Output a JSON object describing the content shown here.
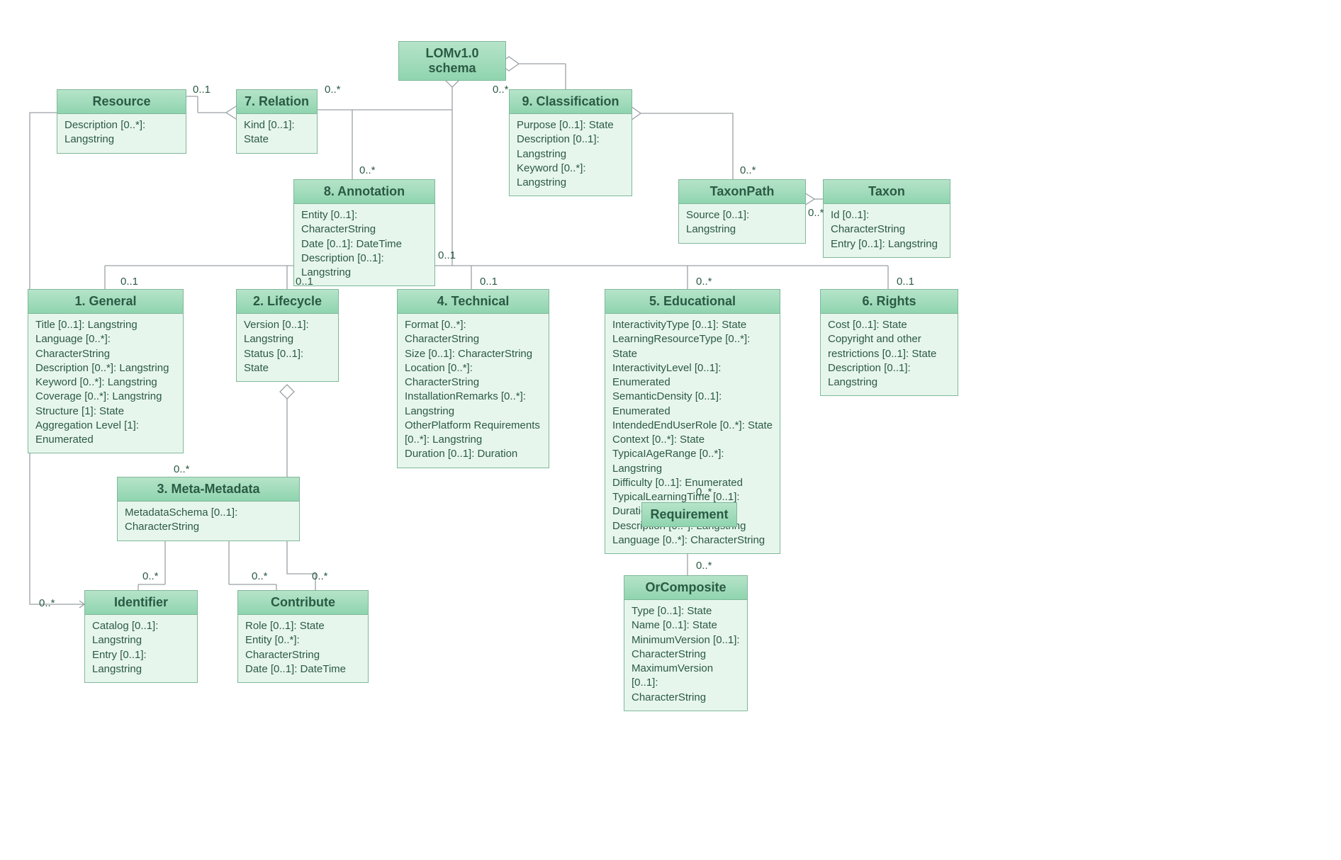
{
  "root": {
    "title": "LOMv1.0 schema"
  },
  "resource": {
    "title": "Resource",
    "attrs": [
      "Description [0..*]: Langstring"
    ]
  },
  "relation": {
    "title": "7. Relation",
    "attrs": [
      "Kind [0..1]: State"
    ]
  },
  "classification": {
    "title": "9. Classification",
    "attrs": [
      "Purpose [0..1]: State",
      "Description [0..1]: Langstring",
      "Keyword [0..*]: Langstring"
    ]
  },
  "annotation": {
    "title": "8. Annotation",
    "attrs": [
      "Entity [0..1]: CharacterString",
      "Date [0..1]: DateTime",
      "Description [0..1]: Langstring"
    ]
  },
  "taxonpath": {
    "title": "TaxonPath",
    "attrs": [
      "Source [0..1]: Langstring"
    ]
  },
  "taxon": {
    "title": "Taxon",
    "attrs": [
      "Id [0..1]: CharacterString",
      "Entry [0..1]: Langstring"
    ]
  },
  "general": {
    "title": "1. General",
    "attrs": [
      "Title [0..1]: Langstring",
      "Language [0..*]: CharacterString",
      "Description [0..*]: Langstring",
      "Keyword [0..*]: Langstring",
      "Coverage [0..*]: Langstring",
      "Structure [1]: State",
      "Aggregation Level [1]: Enumerated"
    ]
  },
  "lifecycle": {
    "title": "2. Lifecycle",
    "attrs": [
      "Version [0..1]:",
      "Langstring",
      "Status [0..1]: State"
    ]
  },
  "technical": {
    "title": "4. Technical",
    "attrs": [
      "Format [0..*]: CharacterString",
      "Size [0..1]: CharacterString",
      "Location [0..*]: CharacterString",
      "InstallationRemarks [0..*]:",
      "Langstring",
      "OtherPlatform Requirements",
      "[0..*]: Langstring",
      "Duration [0..1]: Duration"
    ]
  },
  "educational": {
    "title": "5. Educational",
    "attrs": [
      "InteractivityType [0..1]: State",
      "LearningResourceType [0..*]: State",
      "InteractivityLevel [0..1]: Enumerated",
      "SemanticDensity [0..1]: Enumerated",
      "IntendedEndUserRole [0..*]: State",
      "Context [0..*]: State",
      "TypicaIAgeRange [0..*]: Langstring",
      "Difficulty [0..1]: Enumerated",
      "TypicalLearningTime [0..1]: Duration",
      "Description [0..*]: Langstring",
      "Language [0..*]: CharacterString"
    ]
  },
  "rights": {
    "title": "6. Rights",
    "attrs": [
      "Cost [0..1]: State",
      "Copyright and other",
      "restrictions [0..1]: State",
      "Description [0..1]: Langstring"
    ]
  },
  "metametadata": {
    "title": "3. Meta-Metadata",
    "attrs": [
      "MetadataSchema [0..1]: CharacterString"
    ]
  },
  "identifier": {
    "title": "Identifier",
    "attrs": [
      "Catalog [0..1]: Langstring",
      "Entry [0..1]: Langstring"
    ]
  },
  "contribute": {
    "title": "Contribute",
    "attrs": [
      "Role [0..1]: State",
      "Entity [0..*]: CharacterString",
      "Date [0..1]: DateTime"
    ]
  },
  "requirement": {
    "title": "Requirement"
  },
  "orcomposite": {
    "title": "OrComposite",
    "attrs": [
      "Type [0..1]: State",
      "Name [0..1]: State",
      "MinimumVersion [0..1]:",
      "CharacterString",
      "MaximumVersion [0..1]:",
      "CharacterString"
    ]
  },
  "labels": {
    "m01": "0..1",
    "m0s": "0..*"
  }
}
